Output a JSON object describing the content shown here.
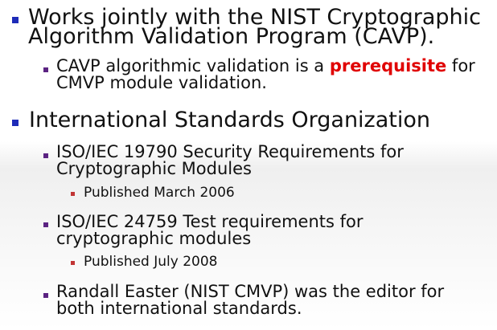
{
  "slide": {
    "colors": {
      "level1_bullet": "#1e2bb8",
      "level2_bullet": "#5b2382",
      "level3_bullet": "#c13535",
      "emphasis": "#e00000"
    },
    "items": [
      {
        "line1": "Works jointly with the NIST Cryptographic",
        "line2": "Algorithm Validation Program (CAVP)."
      },
      {
        "pre": "CAVP algorithmic validation is a ",
        "emphasis": "prerequisite",
        "post": " for",
        "line2": "CMVP module validation."
      },
      {
        "text": "International Standards Organization"
      },
      {
        "line1": "ISO/IEC 19790 Security Requirements for",
        "line2": "Cryptographic Modules"
      },
      {
        "text": "Published March 2006"
      },
      {
        "line1": "ISO/IEC 24759 Test requirements for",
        "line2": "cryptographic modules"
      },
      {
        "text": "Published July 2008"
      },
      {
        "line1": "Randall Easter (NIST CMVP) was the editor for",
        "line2": "both international standards."
      }
    ]
  }
}
